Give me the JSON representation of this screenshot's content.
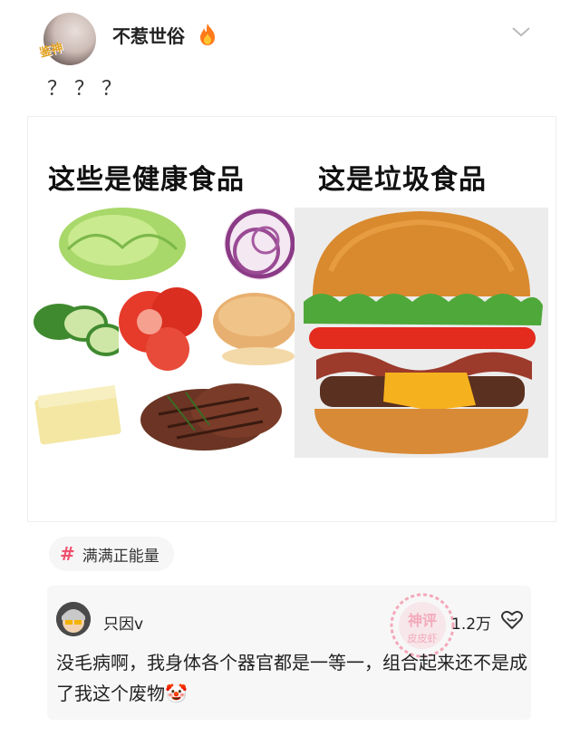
{
  "post": {
    "username": "不惹世俗",
    "avatar_badge": "鉴神",
    "text": "？？？"
  },
  "meme": {
    "left_title": "这些是健康食品",
    "right_title": "这是垃圾食品"
  },
  "tag": {
    "icon": "#",
    "label": "满满正能量"
  },
  "comment": {
    "author": "只因v",
    "likes": "1.2万",
    "text": "没毛病啊，我身体各个器官都是一等一，组合起来还不是成了我这个废物🤡",
    "stamp_text_top": "神评",
    "stamp_text_bottom": "皮皮虾"
  },
  "icons": {
    "flame": "flame-icon",
    "chevron": "chevron-down-icon",
    "like": "like-icon"
  },
  "colors": {
    "accent": "#f0506e",
    "tag_bg": "#f6f6f6",
    "comment_bg": "#f7f7f7"
  }
}
